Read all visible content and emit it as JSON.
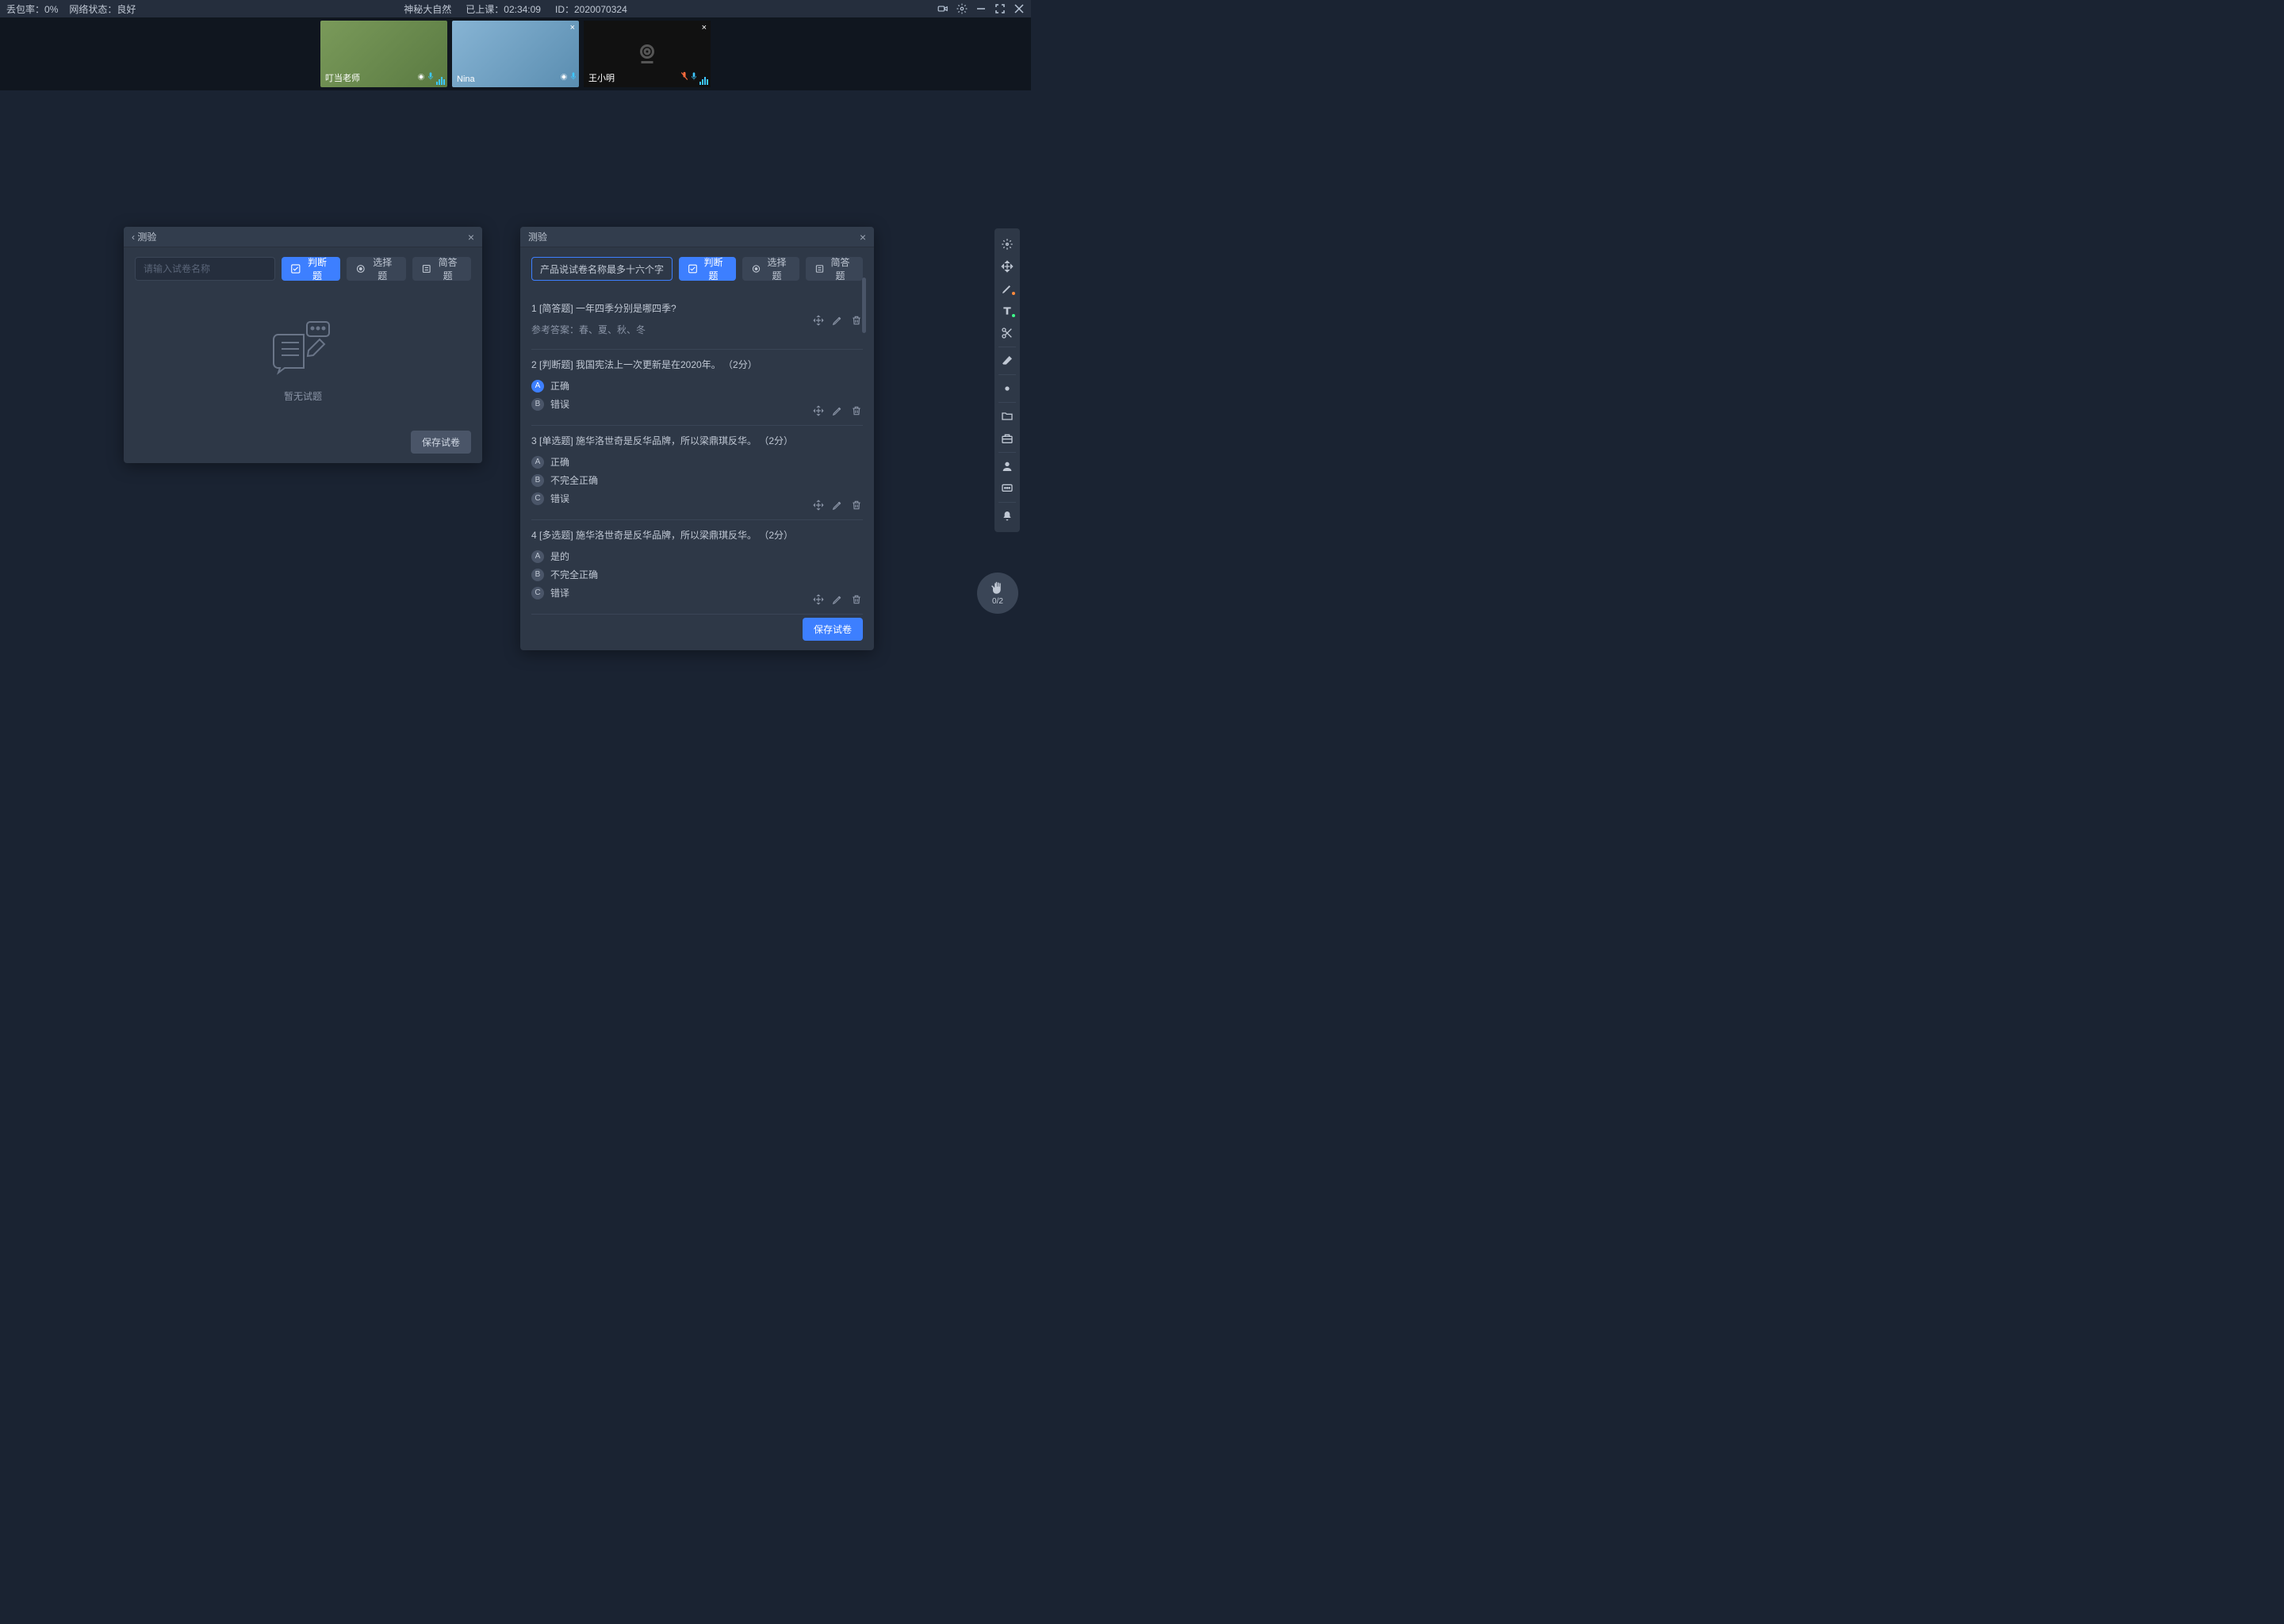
{
  "titlebar": {
    "packet_loss_label": "丢包率：",
    "packet_loss_value": "0%",
    "network_label": "网络状态：",
    "network_value": "良好",
    "course_name": "神秘大自然",
    "elapsed_label": "已上课：",
    "elapsed_value": "02:34:09",
    "id_label": "ID：",
    "id_value": "2020070324"
  },
  "videos": [
    {
      "name": "叮当老师",
      "camera_off": false,
      "muted": false,
      "type": "a"
    },
    {
      "name": "Nina",
      "camera_off": false,
      "muted": false,
      "type": "b",
      "closable": true
    },
    {
      "name": "王小明",
      "camera_off": true,
      "muted": true,
      "type": "c",
      "closable": true
    }
  ],
  "quiz_panel": {
    "title": "测验",
    "name_placeholder": "请输入试卷名称",
    "name_filled": "产品说试卷名称最多十六个字",
    "btn_judge": "判断题",
    "btn_choice": "选择题",
    "btn_short": "简答题",
    "empty_text": "暂无试题",
    "save": "保存试卷"
  },
  "questions": [
    {
      "num": "1",
      "tag": "[简答题]",
      "text": "一年四季分别是哪四季?",
      "reference_label": "参考答案：",
      "reference": "春、夏、秋、冬",
      "options": []
    },
    {
      "num": "2",
      "tag": "[判断题]",
      "text": "我国宪法上一次更新是在2020年。",
      "points": "（2分）",
      "options": [
        {
          "letter": "A",
          "text": "正确",
          "correct": true
        },
        {
          "letter": "B",
          "text": "错误",
          "correct": false
        }
      ]
    },
    {
      "num": "3",
      "tag": "[单选题]",
      "text": "施华洛世奇是反华品牌，所以梁鼎琪反华。",
      "points": "（2分）",
      "options": [
        {
          "letter": "A",
          "text": "正确",
          "correct": false
        },
        {
          "letter": "B",
          "text": "不完全正确",
          "correct": false
        },
        {
          "letter": "C",
          "text": "错误",
          "correct": false
        }
      ]
    },
    {
      "num": "4",
      "tag": "[多选题]",
      "text": "施华洛世奇是反华品牌，所以梁鼎琪反华。",
      "points": "（2分）",
      "options": [
        {
          "letter": "A",
          "text": "是的",
          "correct": false
        },
        {
          "letter": "B",
          "text": "不完全正确",
          "correct": false
        },
        {
          "letter": "C",
          "text": "错译",
          "correct": false
        }
      ]
    }
  ],
  "hand": {
    "count": "0/2"
  }
}
